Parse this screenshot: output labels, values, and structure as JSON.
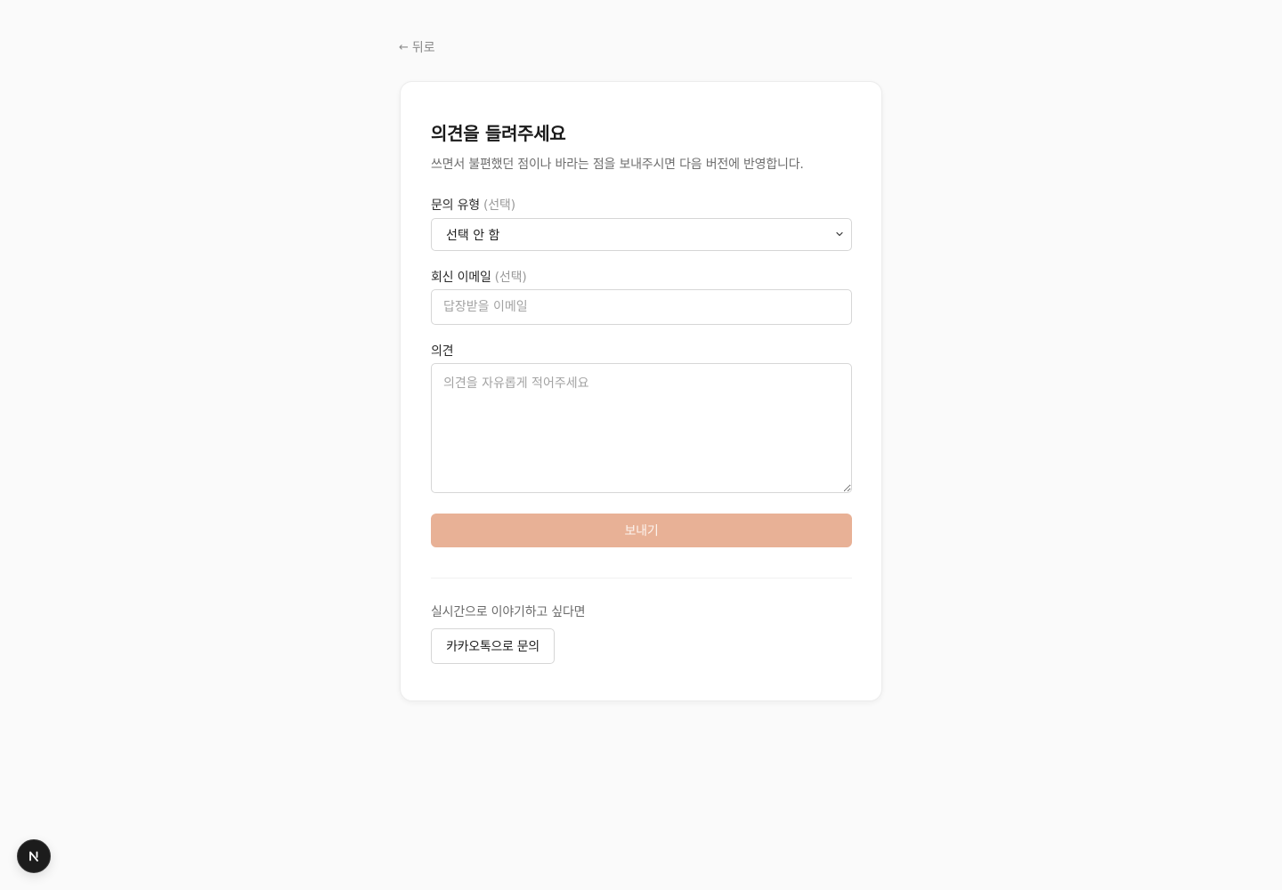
{
  "nav": {
    "back_label": "뒤로"
  },
  "form": {
    "title": "의견을 들려주세요",
    "subtitle": "쓰면서 불편했던 점이나 바라는 점을 보내주시면 다음 버전에 반영합니다.",
    "inquiry_type": {
      "label": "문의 유형",
      "optional_tag": "(선택)",
      "selected_value": "선택 안 함"
    },
    "reply_email": {
      "label": "회신 이메일",
      "optional_tag": "(선택)",
      "placeholder": "답장받을 이메일",
      "value": ""
    },
    "feedback": {
      "label": "의견",
      "placeholder": "의견을 자유롭게 적어주세요",
      "value": ""
    },
    "submit_label": "보내기"
  },
  "realtime": {
    "label": "실시간으로 이야기하고 싶다면",
    "kakao_button_label": "카카오톡으로 문의"
  },
  "colors": {
    "background": "#fafafa",
    "card": "#ffffff",
    "submit_disabled": "#e8b196",
    "badge": "#1c1c1c"
  },
  "icons": {
    "back": "arrow-left-icon",
    "select": "chevron-down-icon",
    "badge": "nextjs-logo-icon"
  }
}
